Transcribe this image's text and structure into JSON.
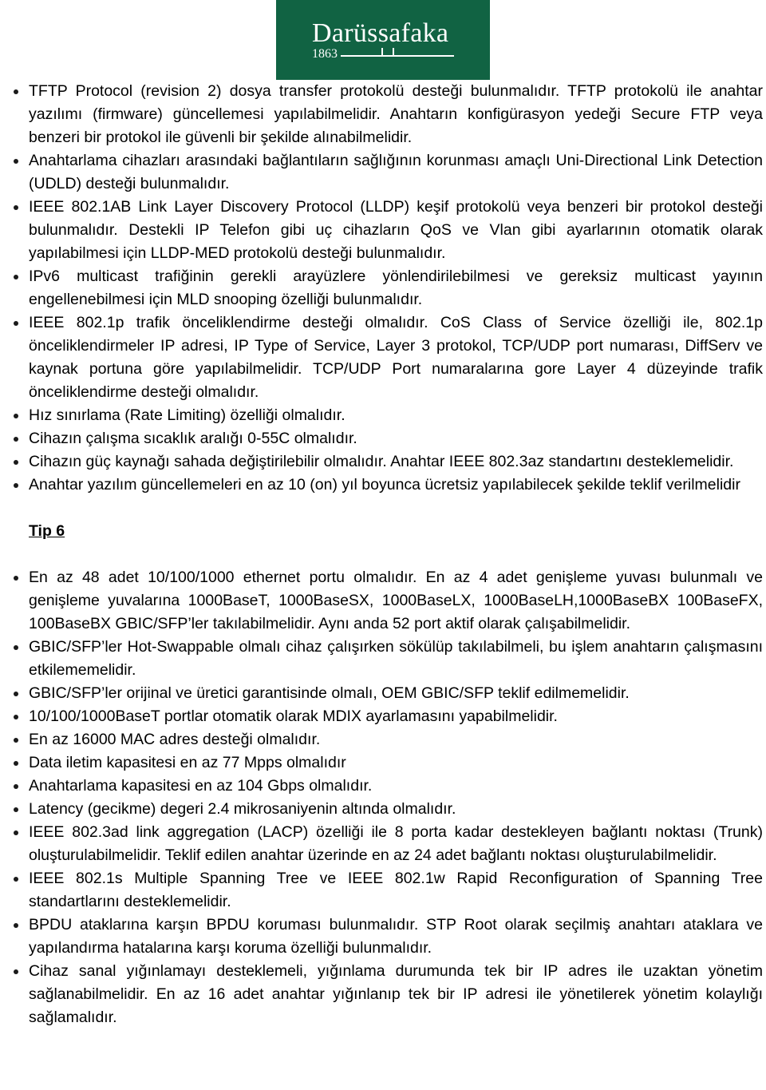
{
  "logo": {
    "name": "Darüssafaka",
    "year": "1863",
    "background_color": "#116343",
    "text_color": "#ffffff"
  },
  "document": {
    "sections": [
      {
        "id": "section-top",
        "heading": null,
        "bullets": [
          "TFTP Protocol (revision 2) dosya transfer protokolü desteği bulunmalıdır. TFTP protokolü ile anahtar yazılımı (firmware) güncellemesi yapılabilmelidir. Anahtarın konfigürasyon yedeği Secure FTP veya benzeri bir protokol ile güvenli bir şekilde alınabilmelidir.",
          "Anahtarlama cihazları arasındaki bağlantıların sağlığının korunması amaçlı Uni-Directional Link Detection (UDLD) desteği bulunmalıdır.",
          "IEEE 802.1AB Link Layer Discovery Protocol (LLDP) keşif protokolü veya benzeri bir protokol desteği bulunmalıdır. Destekli IP Telefon gibi uç cihazların QoS ve Vlan gibi ayarlarının otomatik olarak yapılabilmesi için LLDP-MED protokolü desteği bulunmalıdır.",
          "IPv6 multicast trafiğinin gerekli arayüzlere yönlendirilebilmesi ve gereksiz multicast yayının engellenebilmesi için MLD snooping  özelliği bulunmalıdır.",
          "IEEE 802.1p trafik önceliklendirme desteği olmalıdır. CoS Class of Service özelliği ile, 802.1p önceliklendirmeler IP adresi, IP Type of Service, Layer 3 protokol, TCP/UDP port numarası, DiffServ ve kaynak portuna göre yapılabilmelidir. TCP/UDP Port numaralarına gore Layer 4 düzeyinde trafik önceliklendirme desteği olmalıdır.",
          "Hız sınırlama (Rate Limiting) özelliği olmalıdır.",
          "Cihazın çalışma sıcaklık aralığı 0-55C olmalıdır.",
          "Cihazın güç kaynağı sahada değiştirilebilir olmalıdır. Anahtar IEEE 802.3az standartını desteklemelidir.",
          "Anahtar yazılım güncellemeleri en az 10 (on) yıl boyunca ücretsiz yapılabilecek şekilde teklif verilmelidir"
        ]
      },
      {
        "id": "section-tip-6",
        "heading": "Tip 6",
        "bullets": [
          "En az 48 adet 10/100/1000 ethernet portu olmalıdır. En az 4 adet genişleme yuvası bulunmalı ve genişleme yuvalarına 1000BaseT, 1000BaseSX, 1000BaseLX, 1000BaseLH,1000BaseBX 100BaseFX, 100BaseBX GBIC/SFP’ler takılabilmelidir. Aynı anda 52 port aktif olarak çalışabilmelidir.",
          "GBIC/SFP’ler Hot-Swappable olmalı cihaz çalışırken sökülüp takılabilmeli, bu işlem anahtarın çalışmasını etkilememelidir.",
          "GBIC/SFP’ler orijinal ve üretici garantisinde olmalı, OEM GBIC/SFP teklif edilmemelidir.",
          "10/100/1000BaseT portlar otomatik olarak MDIX ayarlamasını yapabilmelidir.",
          "En az 16000 MAC adres desteği olmalıdır.",
          "Data iletim kapasitesi en az 77 Mpps olmalıdır",
          "Anahtarlama kapasitesi en az 104 Gbps olmalıdır.",
          "Latency (gecikme) degeri 2.4 mikrosaniyenin altında olmalıdır.",
          "IEEE 802.3ad link aggregation (LACP) özelliği ile 8 porta kadar destekleyen bağlantı noktası (Trunk) oluşturulabilmelidir. Teklif edilen anahtar üzerinde en az 24 adet bağlantı noktası oluşturulabilmelidir.",
          "IEEE 802.1s Multiple Spanning Tree ve IEEE 802.1w Rapid Reconfiguration of Spanning Tree standartlarını desteklemelidir.",
          "BPDU ataklarına karşın BPDU koruması bulunmalıdır. STP Root olarak seçilmiş anahtarı ataklara ve yapılandırma hatalarına karşı koruma özelliği bulunmalıdır.",
          "Cihaz sanal yığınlamayı desteklemeli, yığınlama durumunda tek bir IP adres ile uzaktan yönetim sağlanabilmelidir. En az 16 adet anahtar yığınlanıp tek bir IP adresi ile yönetilerek yönetim kolaylığı sağlamalıdır."
        ]
      }
    ]
  }
}
